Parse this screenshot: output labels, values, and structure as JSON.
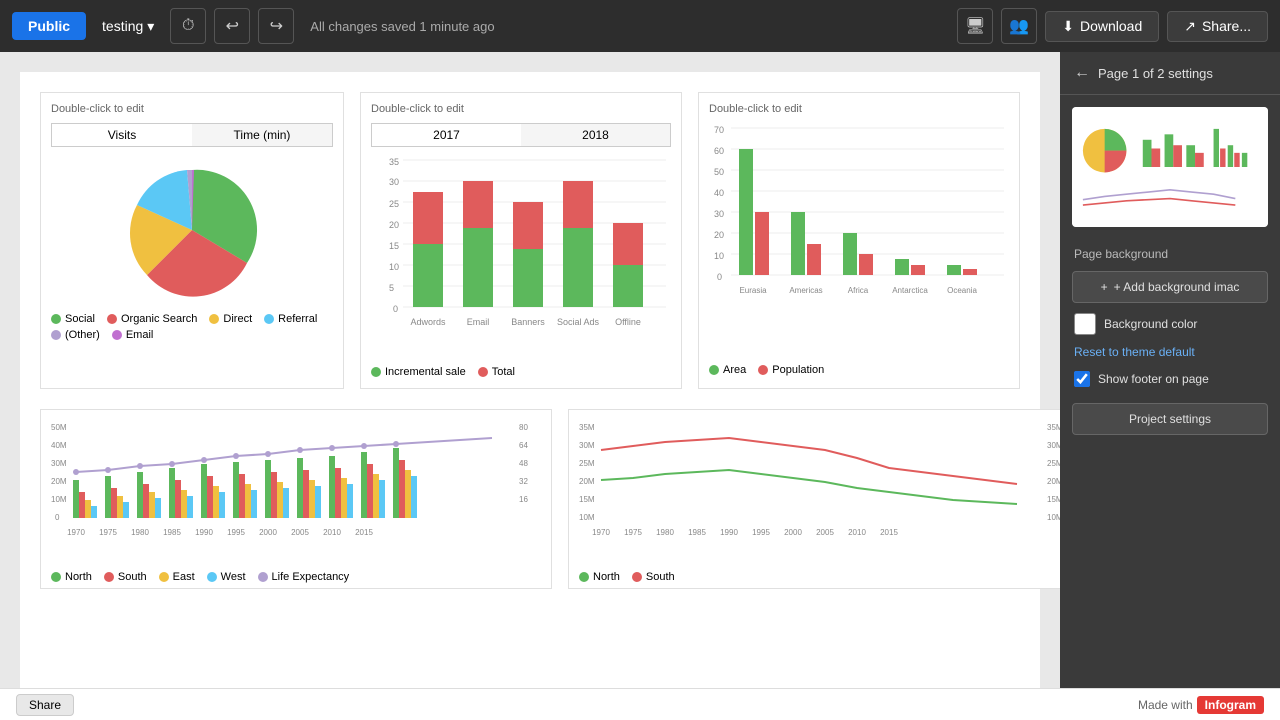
{
  "toolbar": {
    "public_label": "Public",
    "project_name": "testing",
    "saved_text": "All changes saved 1 minute ago",
    "download_label": "Download",
    "share_label": "Share...",
    "chevron": "▾",
    "undo_icon": "↩",
    "redo_icon": "↪",
    "clock_icon": "🕐",
    "screen_icon": "⬜",
    "people_icon": "👥",
    "upload_icon": "⬆",
    "share_icon": "↗"
  },
  "panel": {
    "back_icon": "←",
    "title": "Page 1 of 2 settings",
    "bg_section_title": "Page background",
    "add_bg_image_label": "+ Add background imac",
    "bg_color_label": "Background color",
    "reset_link_label": "Reset to theme default",
    "show_footer_label": "Show footer on page",
    "show_footer_checked": true,
    "project_settings_label": "Project settings"
  },
  "charts": {
    "top_left": {
      "label": "Double-click to edit",
      "tab1": "Visits",
      "tab2": "Time (min)",
      "legend": [
        {
          "name": "Social",
          "color": "#5cb85c"
        },
        {
          "name": "Organic Search",
          "color": "#e05c5c"
        },
        {
          "name": "Direct",
          "color": "#f0c040"
        },
        {
          "name": "Referral",
          "color": "#5bc8f5"
        },
        {
          "name": "(Other)",
          "color": "#b0a0d0"
        },
        {
          "name": "Email",
          "color": "#c070d0"
        }
      ]
    },
    "top_mid": {
      "label": "Double-click to edit",
      "tab1": "2017",
      "tab2": "2018",
      "legend": [
        {
          "name": "Incremental sale",
          "color": "#5cb85c"
        },
        {
          "name": "Total",
          "color": "#e05c5c"
        }
      ]
    },
    "top_right": {
      "label": "Double-click to edit",
      "legend": [
        {
          "name": "Area",
          "color": "#5cb85c"
        },
        {
          "name": "Population",
          "color": "#e05c5c"
        }
      ]
    },
    "bottom_left": {
      "legend": [
        {
          "name": "North",
          "color": "#5cb85c"
        },
        {
          "name": "South",
          "color": "#e05c5c"
        },
        {
          "name": "East",
          "color": "#f0c040"
        },
        {
          "name": "West",
          "color": "#5bc8f5"
        },
        {
          "name": "Life Expectancy",
          "color": "#b0a0d0"
        }
      ]
    },
    "bottom_right": {
      "legend": [
        {
          "name": "North",
          "color": "#5cb85c"
        },
        {
          "name": "South",
          "color": "#e05c5c"
        }
      ]
    }
  },
  "footer": {
    "share_label": "Share",
    "made_with_label": "Made with",
    "brand_label": "Infogram"
  }
}
